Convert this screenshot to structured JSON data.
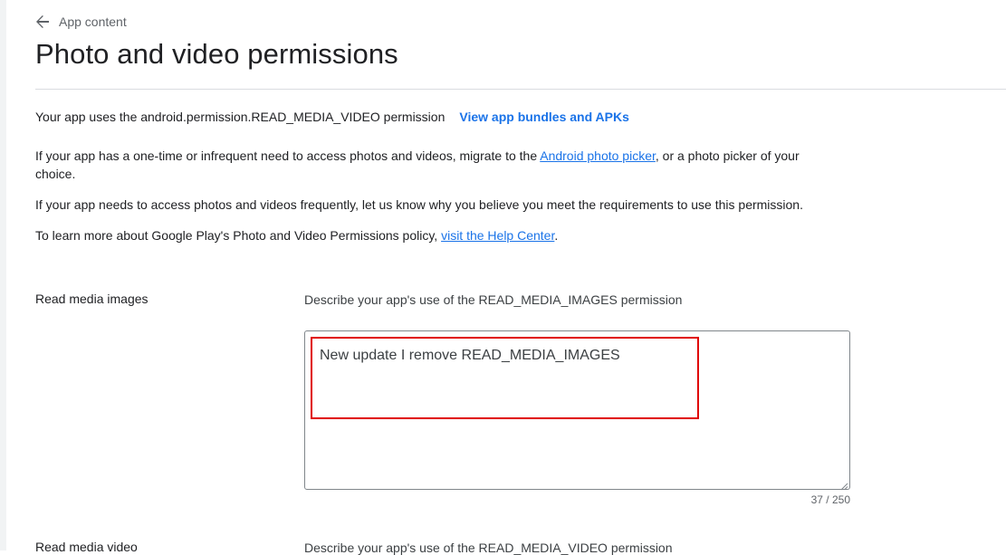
{
  "header": {
    "back_label": "App content",
    "title": "Photo and video permissions"
  },
  "intro": {
    "permission_text": "Your app uses the android.permission.READ_MEDIA_VIDEO permission",
    "view_bundles_link": "View app bundles and APKs",
    "p1_before": "If your app has a one-time or infrequent need to access photos and videos, migrate to the ",
    "p1_link": "Android photo picker",
    "p1_after": ", or a photo picker of your choice.",
    "p2": "If your app needs to access photos and videos frequently, let us know why you believe you meet the requirements to use this permission.",
    "p3_before": "To learn more about Google Play's Photo and Video Permissions policy, ",
    "p3_link": "visit the Help Center",
    "p3_after": "."
  },
  "fields": {
    "images": {
      "label": "Read media images",
      "description": "Describe your app's use of the READ_MEDIA_IMAGES permission",
      "value": "New update I remove READ_MEDIA_IMAGES",
      "char_count": "37 / 250"
    },
    "video": {
      "label": "Read media video",
      "description": "Describe your app's use of the READ_MEDIA_VIDEO permission"
    }
  },
  "colors": {
    "link": "#1a73e8",
    "highlight": "#e00000",
    "divider": "#dadce0"
  },
  "icons": {
    "back": "arrow-back-icon"
  }
}
